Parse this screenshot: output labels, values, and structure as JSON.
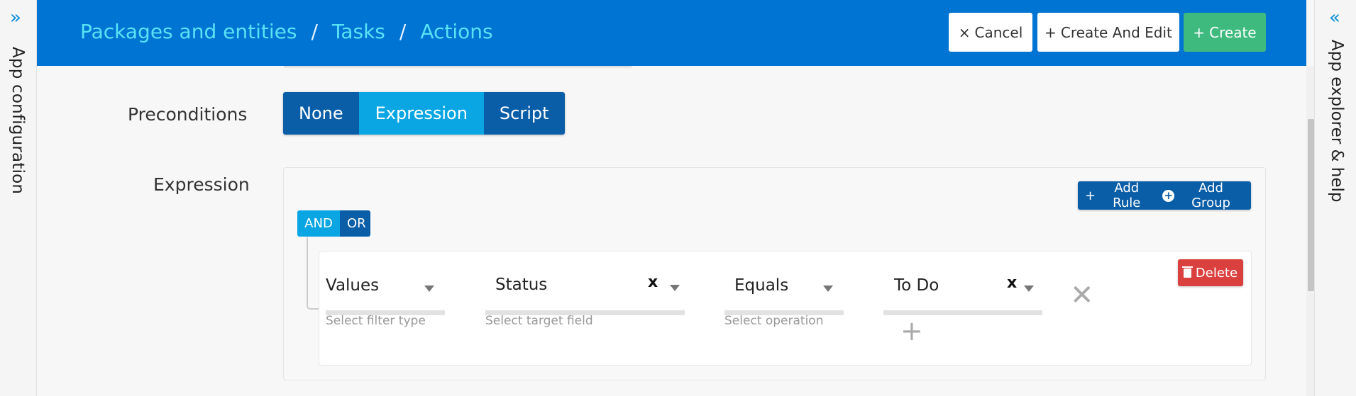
{
  "sidebars": {
    "left": {
      "label": "App configuration",
      "chevron": "»"
    },
    "right": {
      "label": "App explorer & help",
      "chevron": "«"
    }
  },
  "header": {
    "breadcrumb": [
      "Packages and entities",
      "Tasks",
      "Actions"
    ],
    "separator": "/",
    "buttons": {
      "cancel": {
        "icon": "×",
        "label": "Cancel"
      },
      "create_and_edit": {
        "icon": "+",
        "label": "Create And Edit"
      },
      "create": {
        "icon": "+",
        "label": "Create"
      }
    }
  },
  "preconditions": {
    "label": "Preconditions",
    "options": [
      "None",
      "Expression",
      "Script"
    ],
    "selected": "Expression"
  },
  "expression": {
    "label": "Expression",
    "add_rule": {
      "icon": "+",
      "label": "Add Rule"
    },
    "add_group": {
      "icon": "+",
      "label": "Add Group"
    },
    "logic": {
      "and": "AND",
      "or": "OR",
      "selected": "AND"
    },
    "rule": {
      "filter_type": {
        "value": "Values",
        "helper": "Select filter type"
      },
      "target_field": {
        "value": "Status",
        "helper": "Select target field",
        "clear": "x"
      },
      "operation": {
        "value": "Equals",
        "helper": "Select operation"
      },
      "value": {
        "value": "To Do",
        "clear": "x"
      },
      "remove_icon": "✕",
      "add_value_icon": "+",
      "delete": {
        "label": "Delete"
      }
    }
  },
  "colors": {
    "header": "#0074d3",
    "breadcrumb": "#58e3f5",
    "create": "#3fba7e",
    "segment_dark": "#0a5ea8",
    "segment_active": "#09a6e3",
    "delete": "#d9403e"
  }
}
